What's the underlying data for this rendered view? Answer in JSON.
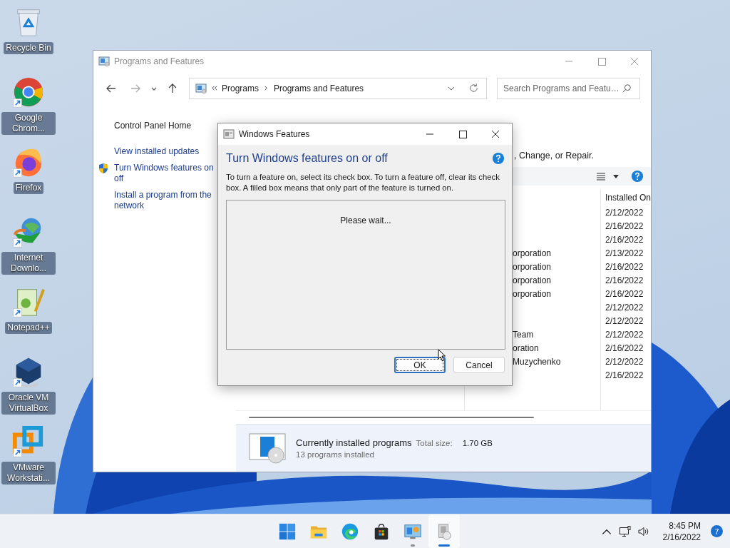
{
  "desktop_icons": [
    {
      "kind": "recycle",
      "label": "Recycle Bin",
      "shortcut": false
    },
    {
      "kind": "chrome",
      "label": "Google Chrom...",
      "shortcut": true
    },
    {
      "kind": "firefox",
      "label": "Firefox",
      "shortcut": true
    },
    {
      "kind": "idm",
      "label": "Internet Downlo...",
      "shortcut": true
    },
    {
      "kind": "notepad",
      "label": "Notepad++",
      "shortcut": true
    },
    {
      "kind": "virtualbox",
      "label": "Oracle VM VirtualBox",
      "shortcut": true
    },
    {
      "kind": "vmware",
      "label": "VMware Workstati...",
      "shortcut": true
    }
  ],
  "main_window": {
    "title": "Programs and Features",
    "address": [
      "Programs",
      "Programs and Features"
    ],
    "search": {
      "placeholder": "Search Programs and Featu…"
    },
    "sidebar": [
      {
        "kind": "home",
        "lines": [
          "Control Panel Home"
        ]
      },
      {
        "kind": "link",
        "lines": [
          "View installed updates"
        ]
      },
      {
        "kind": "shield-link",
        "lines": [
          "Turn Windows features on",
          "off"
        ]
      },
      {
        "kind": "link",
        "lines": [
          "Install a program from the network"
        ]
      }
    ],
    "intro": ", Change, or Repair.",
    "table": {
      "columns": [
        "Installed On"
      ],
      "rows": [
        {
          "installed_on": "2/12/2022"
        },
        {
          "installed_on": "2/16/2022"
        },
        {
          "installed_on": "2/16/2022"
        },
        {
          "publisher": "orporation",
          "installed_on": "2/13/2022"
        },
        {
          "publisher": "orporation",
          "installed_on": "2/16/2022"
        },
        {
          "publisher": "orporation",
          "installed_on": "2/16/2022"
        },
        {
          "publisher": "orporation",
          "installed_on": "2/16/2022"
        },
        {
          "installed_on": "2/12/2022"
        },
        {
          "installed_on": "2/12/2022"
        },
        {
          "publisher": "Team",
          "installed_on": "2/12/2022"
        },
        {
          "publisher": "oration",
          "installed_on": "2/16/2022"
        },
        {
          "publisher": "Muzychenko",
          "installed_on": "2/12/2022"
        },
        {
          "installed_on": "2/16/2022"
        }
      ]
    },
    "details": {
      "title": "Currently installed programs",
      "size_label": "Total size:",
      "size": "1.70 GB",
      "count": "13 programs installed"
    }
  },
  "dialog": {
    "title": "Windows Features",
    "heading": "Turn Windows features on or off",
    "description": "To turn a feature on, select its check box. To turn a feature off, clear its check box. A filled box means that only part of the feature is turned on.",
    "status": "Please wait...",
    "buttons": [
      {
        "label": "OK",
        "default": true
      },
      {
        "label": "Cancel",
        "default": false
      }
    ]
  },
  "taskbar": {
    "apps": [
      {
        "kind": "start",
        "running": false,
        "active": false
      },
      {
        "kind": "explorer",
        "running": false,
        "active": false
      },
      {
        "kind": "edge",
        "running": false,
        "active": false
      },
      {
        "kind": "store",
        "running": false,
        "active": false
      },
      {
        "kind": "control",
        "running": true,
        "active": false
      },
      {
        "kind": "programs",
        "running": true,
        "active": true
      }
    ],
    "clock": {
      "time": "8:45 PM",
      "date": "2/16/2022"
    },
    "notifications": "7"
  }
}
